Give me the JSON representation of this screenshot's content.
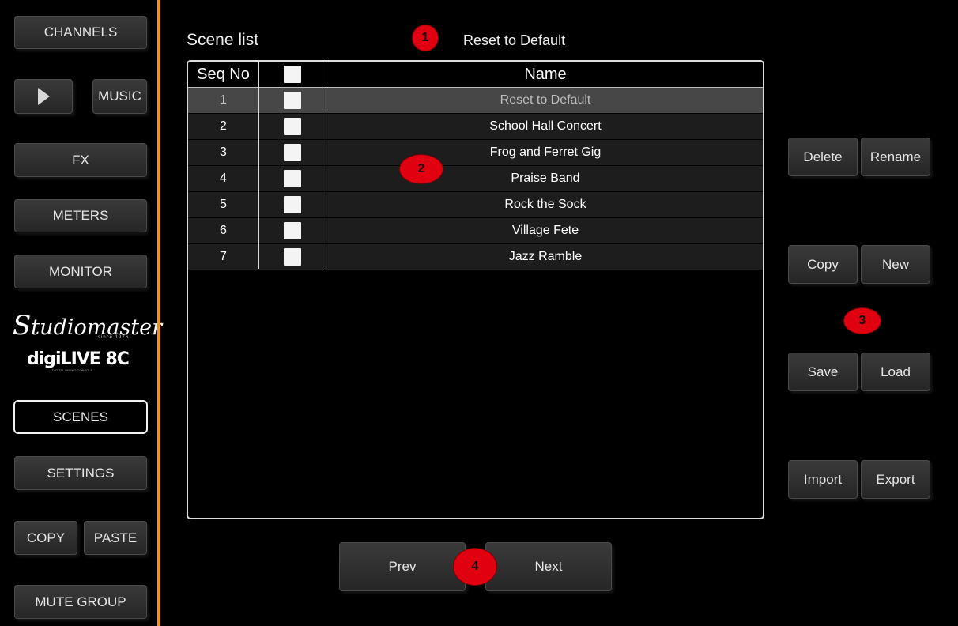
{
  "sidebar": {
    "channels": "CHANNELS",
    "music": "MUSIC",
    "fx": "FX",
    "meters": "METERS",
    "monitor": "MONITOR",
    "scenes": "SCENES",
    "settings": "SETTINGS",
    "copy": "COPY",
    "paste": "PASTE",
    "mute_group": "MUTE GROUP",
    "active_item": "SCENES",
    "play_icon": "play-icon"
  },
  "logo": {
    "brand_initial": "S",
    "brand_rest": "tudiomaster",
    "tagline": "since 1976",
    "product": "digiLIVE 8C",
    "product_sub": "DIGITAL MIXING CONSOLE"
  },
  "scene_panel": {
    "title": "Scene list",
    "current_scene": "Reset to Default",
    "columns": [
      "Seq No",
      "",
      "Name"
    ],
    "selected_index": 0,
    "rows": [
      {
        "seq": "1",
        "name": "Reset to Default"
      },
      {
        "seq": "2",
        "name": "School Hall Concert"
      },
      {
        "seq": "3",
        "name": "Frog and Ferret Gig"
      },
      {
        "seq": "4",
        "name": "Praise Band"
      },
      {
        "seq": "5",
        "name": "Rock the Sock"
      },
      {
        "seq": "6",
        "name": "Village Fete"
      },
      {
        "seq": "7",
        "name": "Jazz Ramble"
      }
    ]
  },
  "actions": {
    "delete": "Delete",
    "rename": "Rename",
    "copy": "Copy",
    "new": "New",
    "save": "Save",
    "load": "Load",
    "import": "Import",
    "export": "Export"
  },
  "pager": {
    "prev": "Prev",
    "next": "Next"
  },
  "markers": [
    "1",
    "2",
    "3",
    "4"
  ],
  "colors": {
    "accent_divider": "#f0921e",
    "marker": "#e0000f",
    "selected_row": "#474747"
  }
}
